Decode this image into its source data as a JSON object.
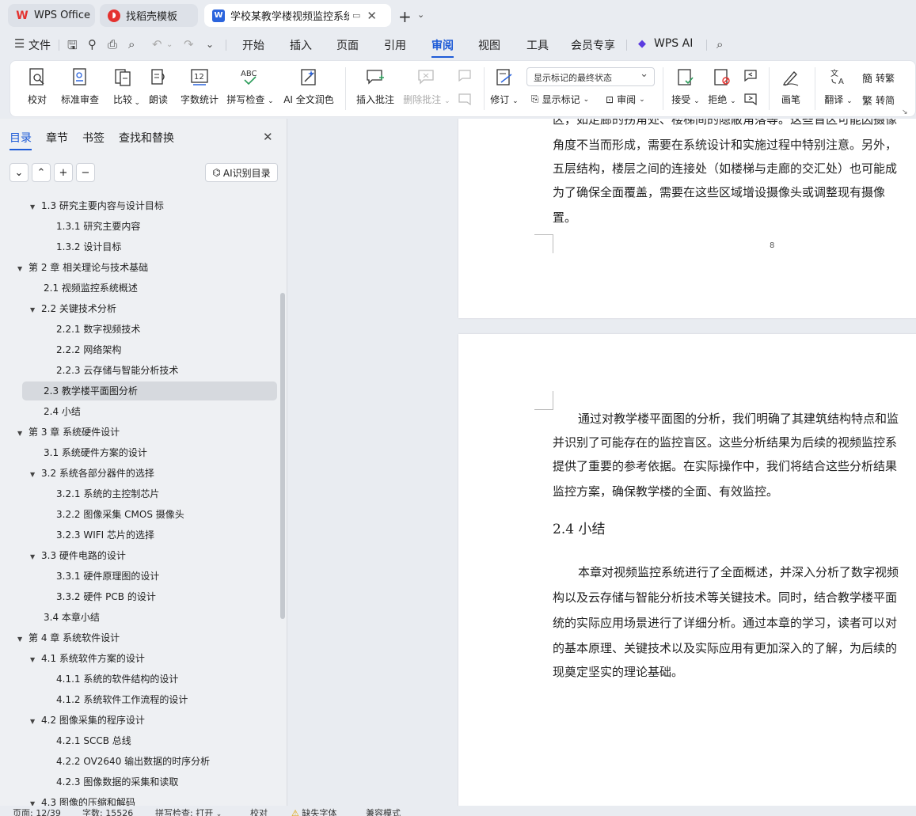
{
  "tabs": [
    {
      "label": "WPS Office"
    },
    {
      "label": "找稻壳模板"
    },
    {
      "label": "学校某教学楼视频监控系统的"
    }
  ],
  "menu": {
    "file": "文件",
    "items": [
      "开始",
      "插入",
      "页面",
      "引用",
      "审阅",
      "视图",
      "工具",
      "会员专享"
    ],
    "ai": "WPS AI"
  },
  "ribbon": {
    "proofread": "校对",
    "std_review": "标准审查",
    "compare": "比较",
    "read_aloud": "朗读",
    "word_count": "字数统计",
    "spell_check": "拼写检查",
    "ai_polish": "AI 全文润色",
    "insert_comment": "插入批注",
    "delete_comment": "删除批注",
    "track_changes": "修订",
    "markup_state": "显示标记的最终状态",
    "show_markup": "显示标记",
    "review": "审阅",
    "accept": "接受",
    "reject": "拒绝",
    "pen": "画笔",
    "translate": "翻译",
    "to_traditional": "转繁",
    "to_simplified": "转简"
  },
  "pane": {
    "tabs": [
      "目录",
      "章节",
      "书签",
      "查找和替换"
    ],
    "ai_toc": "AI识别目录",
    "toc": [
      {
        "text": "1.3  研究主要内容与设计目标"
      },
      {
        "text": "1.3.1  研究主要内容"
      },
      {
        "text": "1.3.2  设计目标"
      },
      {
        "text": "第 2 章  相关理论与技术基础"
      },
      {
        "text": "2.1  视频监控系统概述"
      },
      {
        "text": "2.2  关键技术分析"
      },
      {
        "text": "2.2.1  数字视频技术"
      },
      {
        "text": "2.2.2  网络架构"
      },
      {
        "text": "2.2.3  云存储与智能分析技术"
      },
      {
        "text": "2.3  教学楼平面图分析"
      },
      {
        "text": "2.4  小结"
      },
      {
        "text": "第 3 章  系统硬件设计"
      },
      {
        "text": "3.1 系统硬件方案的设计"
      },
      {
        "text": "3.2 系统各部分器件的选择"
      },
      {
        "text": "3.2.1 系统的主控制芯片"
      },
      {
        "text": "3.2.2 图像采集 CMOS 摄像头"
      },
      {
        "text": "3.2.3 WIFI 芯片的选择"
      },
      {
        "text": "3.3 硬件电路的设计"
      },
      {
        "text": "3.3.1 硬件原理图的设计"
      },
      {
        "text": "3.3.2 硬件 PCB 的设计"
      },
      {
        "text": "3.4 本章小结"
      },
      {
        "text": "第 4 章  系统软件设计"
      },
      {
        "text": "4.1 系统软件方案的设计"
      },
      {
        "text": "4.1.1 系统的软件结构的设计"
      },
      {
        "text": "4.1.2 系统软件工作流程的设计"
      },
      {
        "text": "4.2 图像采集的程序设计"
      },
      {
        "text": "4.2.1 SCCB 总线"
      },
      {
        "text": "4.2.2 OV2640 输出数据的时序分析"
      },
      {
        "text": "4.2.3 图像数据的采集和读取"
      },
      {
        "text": "4.3 图像的压缩和解码"
      }
    ]
  },
  "doc": {
    "p1_lines": [
      "区，如走廊的拐角处、楼梯间的隐蔽角落等。这些盲区可能因摄像",
      "角度不当而形成，需要在系统设计和实施过程中特别注意。另外，",
      "五层结构，楼层之间的连接处（如楼梯与走廊的交汇处）也可能成",
      "为了确保全面覆盖，需要在这些区域增设摄像头或调整现有摄像",
      "置。"
    ],
    "page_num": "8",
    "p2_para1": [
      "通过对教学楼平面图的分析，我们明确了其建筑结构特点和监",
      "并识别了可能存在的监控盲区。这些分析结果为后续的视频监控系",
      "提供了重要的参考依据。在实际操作中，我们将结合这些分析结果",
      "监控方案，确保教学楼的全面、有效监控。"
    ],
    "heading": "2.4  小结",
    "p2_para2": [
      "本章对视频监控系统进行了全面概述，并深入分析了数字视频",
      "构以及云存储与智能分析技术等关键技术。同时，结合教学楼平面",
      "统的实际应用场景进行了详细分析。通过本章的学习，读者可以对",
      "的基本原理、关键技术以及实际应用有更加深入的了解，为后续的",
      "现奠定坚实的理论基础。"
    ]
  },
  "status": {
    "page": "页面: 12/39",
    "words": "字数: 15526",
    "spell": "拼写检查: 打开",
    "proof": "校对",
    "missing_font": "缺失字体",
    "compat": "兼容模式"
  }
}
